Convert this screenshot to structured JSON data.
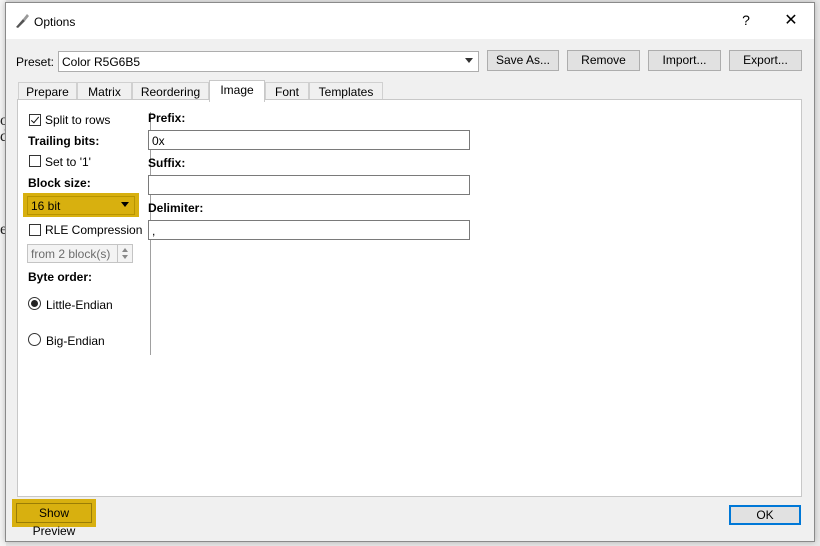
{
  "window": {
    "title": "Options",
    "help_label": "?",
    "close_label": "✕"
  },
  "preset": {
    "label": "Preset:",
    "value": "Color R5G6B5"
  },
  "buttons": {
    "save_as": "Save As...",
    "remove": "Remove",
    "import": "Import...",
    "export": "Export...",
    "show_preview": "Show Preview",
    "ok": "OK"
  },
  "tabs": [
    {
      "label": "Prepare"
    },
    {
      "label": "Matrix"
    },
    {
      "label": "Reordering"
    },
    {
      "label": "Image"
    },
    {
      "label": "Font"
    },
    {
      "label": "Templates"
    }
  ],
  "active_tab": "Image",
  "left": {
    "split_to_rows": "Split to rows",
    "trailing_bits": "Trailing bits:",
    "set_to_1": "Set to '1'",
    "block_size_label": "Block size:",
    "block_size_value": "16 bit",
    "rle_compression": "RLE Compression",
    "rle_from": "from 2 block(s)",
    "byte_order_label": "Byte order:",
    "little_endian": "Little-Endian",
    "big_endian": "Big-Endian"
  },
  "right": {
    "prefix_label": "Prefix:",
    "prefix_value": "0x",
    "suffix_label": "Suffix:",
    "suffix_value": "",
    "delimiter_label": "Delimiter:",
    "delimiter_value": ","
  },
  "background_glyphs": [
    "o",
    "d",
    "e"
  ],
  "colors": {
    "highlight": "#d8b00f",
    "focus": "#0078d7"
  }
}
